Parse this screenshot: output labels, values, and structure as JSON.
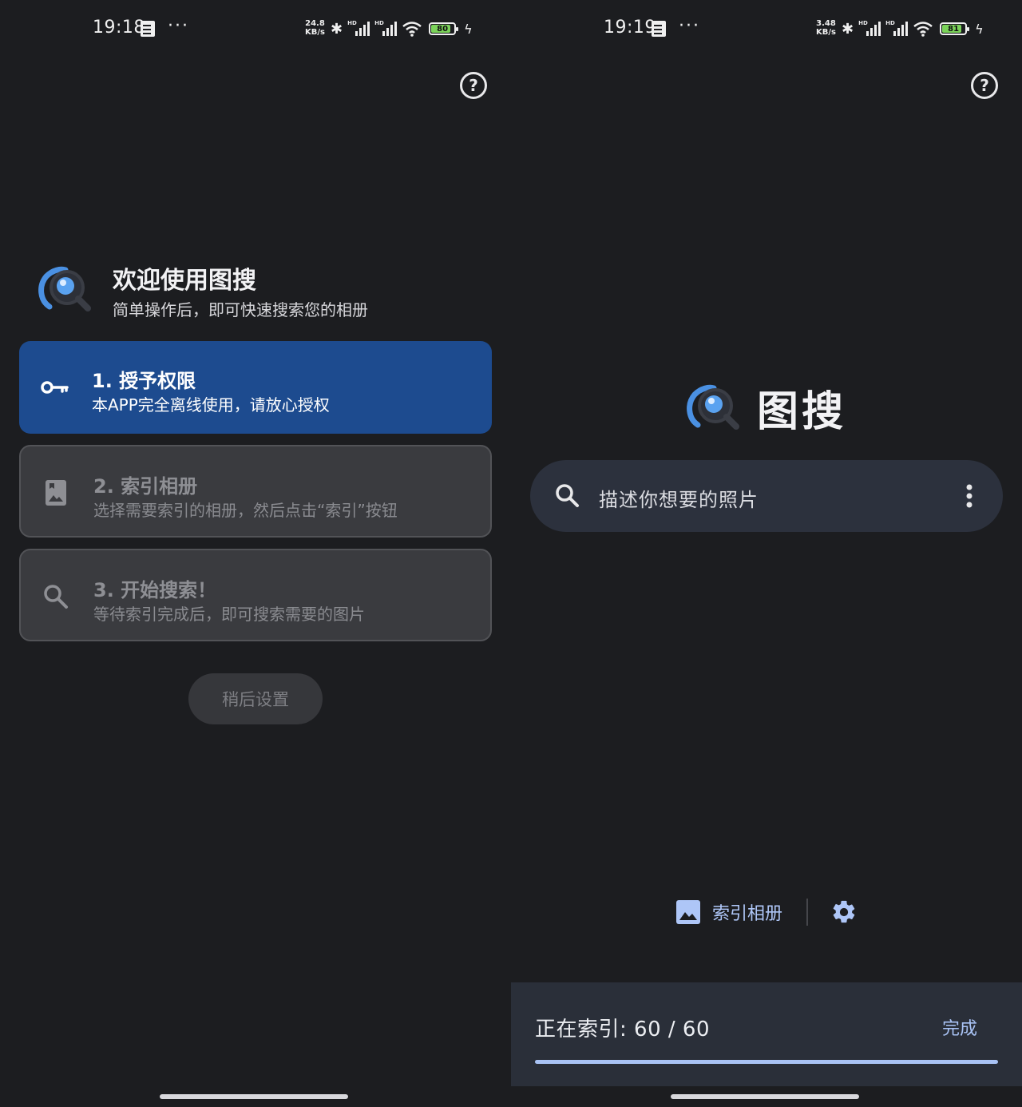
{
  "left": {
    "status": {
      "time": "19:18",
      "speed_value": "24.8",
      "speed_unit": "KB/s",
      "hd": "HD",
      "battery": "80"
    },
    "welcome": {
      "title": "欢迎使用图搜",
      "subtitle": "简单操作后，即可快速搜索您的相册"
    },
    "steps": [
      {
        "title": "1. 授予权限",
        "desc": "本APP完全离线使用，请放心授权",
        "icon": "key-icon",
        "state": "active"
      },
      {
        "title": "2. 索引相册",
        "desc": "选择需要索引的相册，然后点击“索引”按钮",
        "icon": "photo-album-icon",
        "state": "disabled"
      },
      {
        "title": "3. 开始搜索！",
        "desc": "等待索引完成后，即可搜索需要的图片",
        "icon": "search-icon",
        "state": "disabled"
      }
    ],
    "later_button": "稍后设置"
  },
  "right": {
    "status": {
      "time": "19:19",
      "speed_value": "3.48",
      "speed_unit": "KB/s",
      "hd": "HD",
      "battery": "81"
    },
    "app_name": "图搜",
    "search": {
      "placeholder": "描述你想要的照片"
    },
    "index_album_button": "索引相册",
    "snackbar": {
      "text": "正在索引: 60 / 60",
      "action": "完成",
      "progress": 1.0
    }
  },
  "colors": {
    "background": "#1c1d20",
    "active_step": "#1d4b8f",
    "accent": "#a9c3f5",
    "logo_blue": "#4a90e2"
  }
}
